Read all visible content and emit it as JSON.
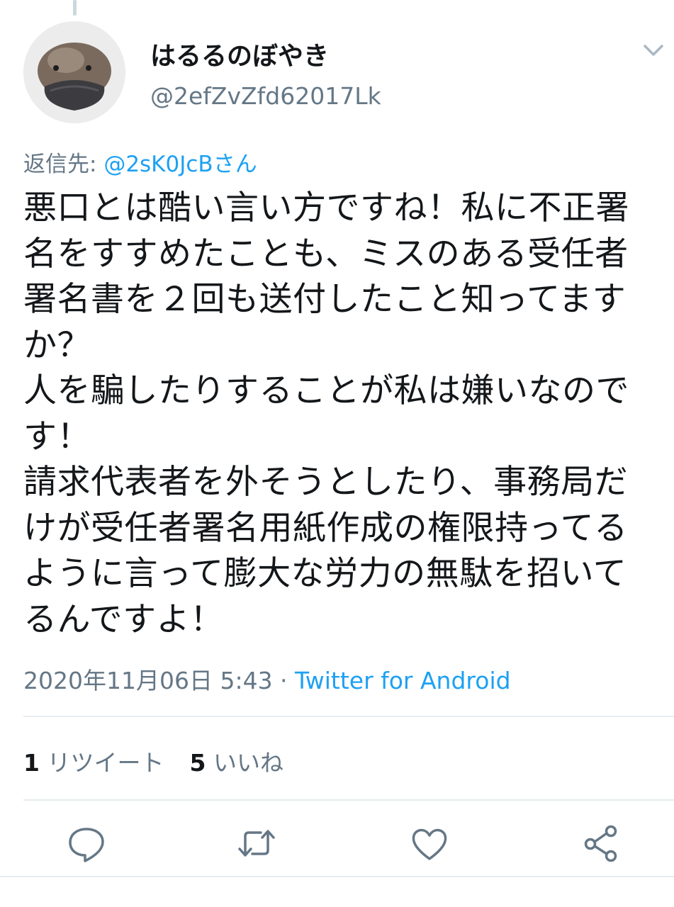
{
  "tweet": {
    "display_name": "はるるのぼやき",
    "handle": "@2efZvZfd62017Lk",
    "reply_to_prefix": "返信先: ",
    "reply_to_mention": "@2sK0JcBさん",
    "body": "悪口とは酷い言い方ですね！私に不正署\n名をすすめたことも、ミスのある受任者\n署名書を２回も送付したこと知ってます\nか？\n人を騙したりすることが私は嫌いなので\nす！\n請求代表者を外そうとしたり、事務局だ\nけが受任者署名用紙作成の権限持ってる\nように言って膨大な労力の無駄を招いて\nるんですよ！",
    "timestamp": "2020年11月06日 5:43 · ",
    "client": "Twitter for Android"
  },
  "stats": {
    "retweets_count": "1",
    "retweets_label": "リツイート",
    "likes_count": "5",
    "likes_label": "いいね"
  },
  "icons": {
    "avatar": "platypus-avatar",
    "menu": "chevron-down-icon",
    "reply": "reply-icon",
    "retweet": "retweet-icon",
    "like": "heart-icon",
    "share": "share-icon"
  },
  "colors": {
    "text": "#14171a",
    "muted": "#657786",
    "link": "#1da1f2",
    "divider": "#e6ecf0"
  }
}
